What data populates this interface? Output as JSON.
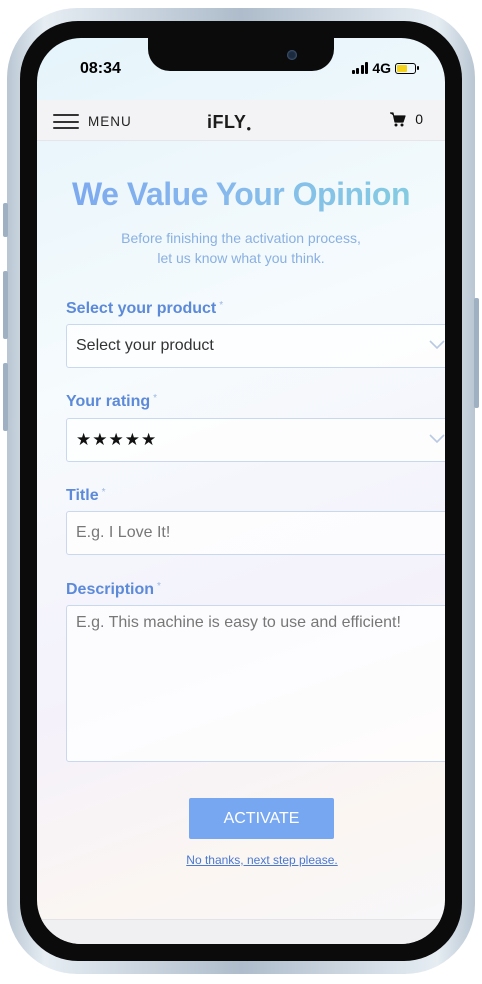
{
  "status_bar": {
    "time": "08:34",
    "network": "4G",
    "battery_color": "#f5d21a"
  },
  "nav": {
    "menu_label": "MENU",
    "menu_icon": "hamburger-icon",
    "logo": "iFLY",
    "cart_icon": "cart-icon",
    "cart_count": "0"
  },
  "header": {
    "title": "We Value Your Opinion",
    "subtitle_line1": "Before finishing the activation process,",
    "subtitle_line2": "let us know what you think."
  },
  "form": {
    "product": {
      "label": "Select your product",
      "required_mark": "*",
      "selected": "Select your product"
    },
    "rating": {
      "label": "Your rating",
      "required_mark": "*",
      "value": "★★★★★"
    },
    "title": {
      "label": "Title",
      "required_mark": "*",
      "placeholder": "E.g. I Love It!"
    },
    "description": {
      "label": "Description",
      "required_mark": "*",
      "placeholder": "E.g. This machine is easy to use and efficient!"
    }
  },
  "actions": {
    "activate_label": "ACTIVATE",
    "skip_label": "No thanks, next step please."
  },
  "colors": {
    "accent": "#78a7f2",
    "label": "#5c8ad9",
    "title_gradient_start": "#7aa6ef",
    "title_gradient_end": "#84cfdf"
  }
}
